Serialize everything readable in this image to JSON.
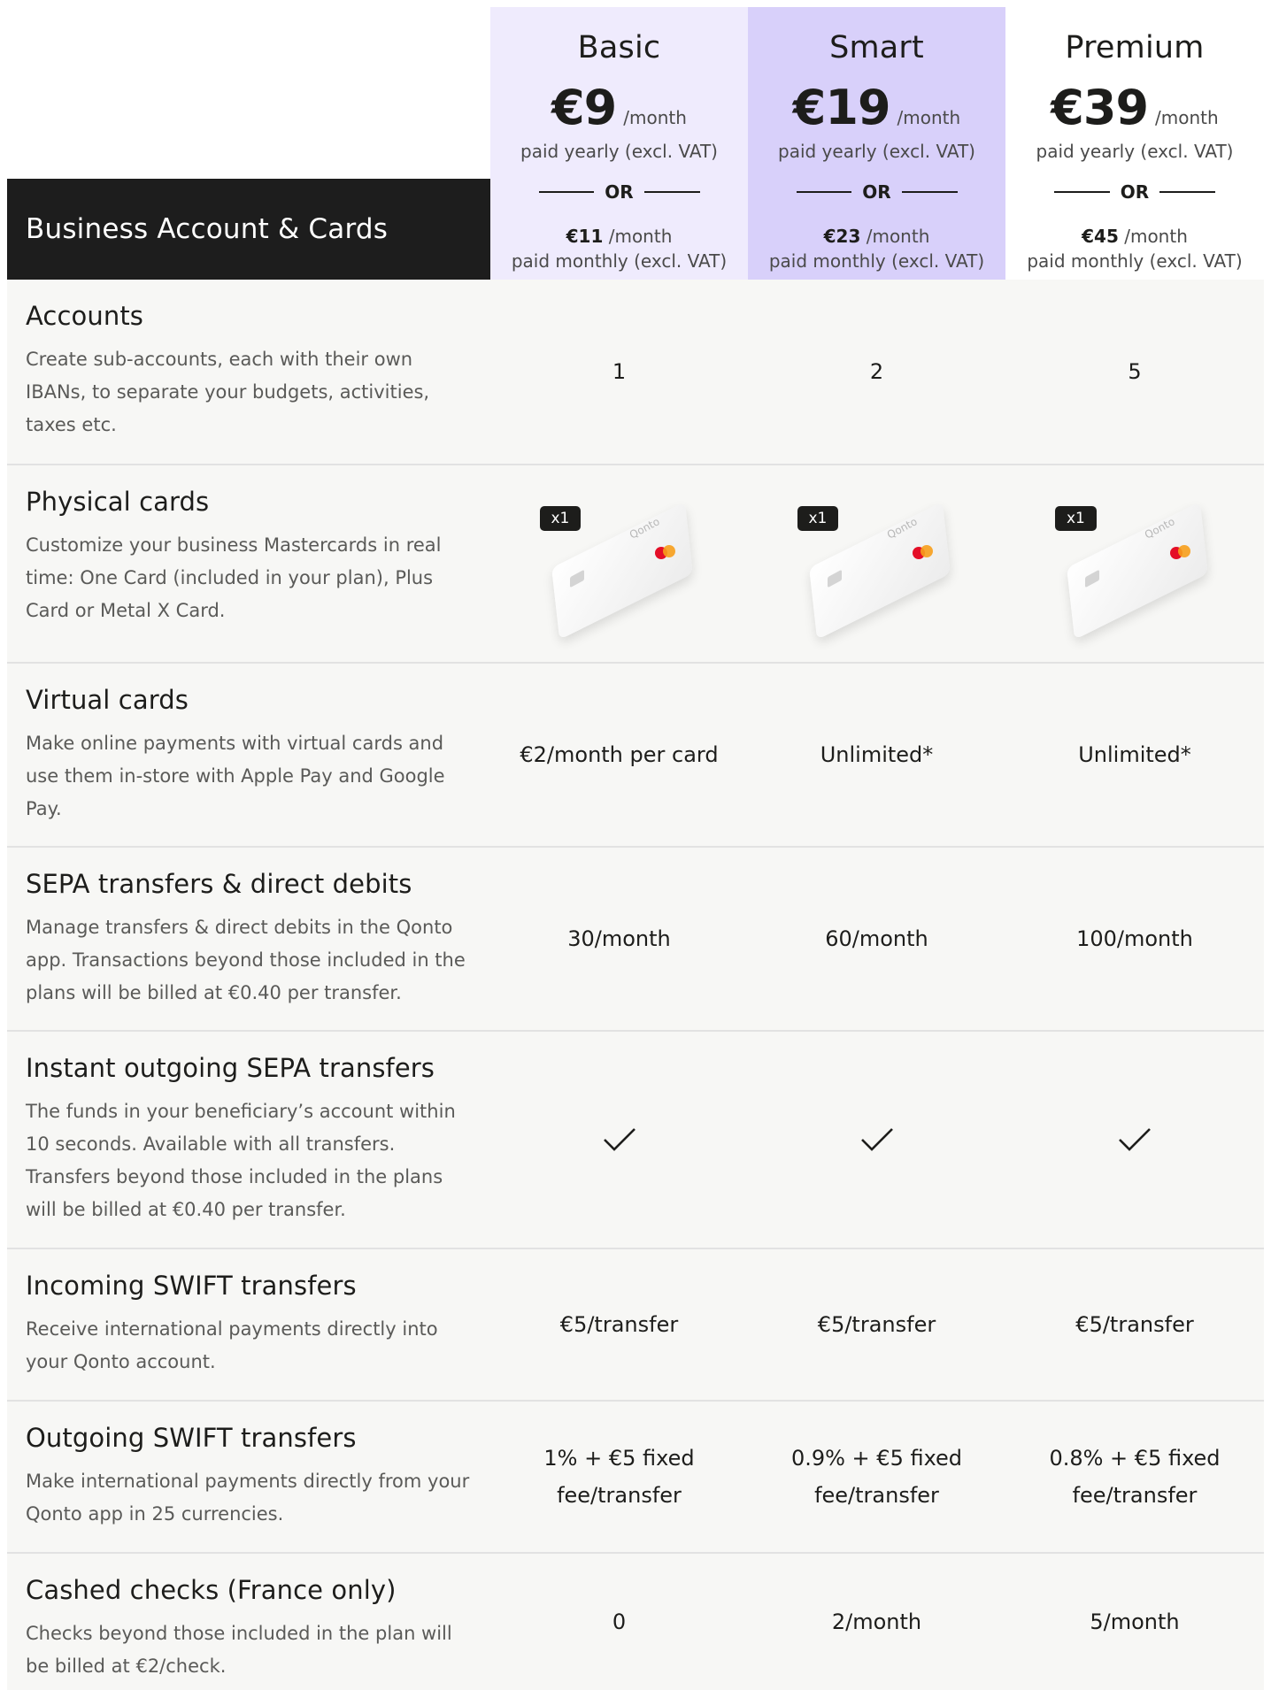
{
  "section_title": "Business Account & Cards",
  "plans": [
    {
      "key": "basic",
      "name": "Basic",
      "price": "€9",
      "unit": "/month",
      "yearly_note": "paid yearly (excl. VAT)",
      "or": "OR",
      "monthly_price": "€11",
      "monthly_unit": "/month",
      "monthly_note": "paid monthly (excl. VAT)"
    },
    {
      "key": "smart",
      "name": "Smart",
      "price": "€19",
      "unit": "/month",
      "yearly_note": "paid yearly (excl. VAT)",
      "or": "OR",
      "monthly_price": "€23",
      "monthly_unit": "/month",
      "monthly_note": "paid monthly (excl. VAT)"
    },
    {
      "key": "premium",
      "name": "Premium",
      "price": "€39",
      "unit": "/month",
      "yearly_note": "paid yearly (excl. VAT)",
      "or": "OR",
      "monthly_price": "€45",
      "monthly_unit": "/month",
      "monthly_note": "paid monthly (excl. VAT)"
    }
  ],
  "colors": {
    "basic_bg": "#efebfd",
    "smart_bg": "#d8d0fa",
    "title_bg": "#1d1d1d",
    "row_bg": "#f7f7f5"
  },
  "rows": [
    {
      "title": "Accounts",
      "desc": "Create sub-accounts, each with their own IBANs, to separate your budgets, activities, taxes etc.",
      "values": [
        "1",
        "2",
        "5"
      ]
    },
    {
      "title": "Physical cards",
      "desc": "Customize your business Mastercards in real time: One Card (included in your plan), Plus Card or Metal X Card.",
      "card_badge": "x1",
      "card_logo": "Qonto",
      "values": [
        "",
        "",
        ""
      ]
    },
    {
      "title": "Virtual cards",
      "desc": "Make online payments with virtual cards and use them in-store with Apple Pay and Google Pay.",
      "values": [
        "€2/month per card",
        "Unlimited*",
        "Unlimited*"
      ]
    },
    {
      "title": "SEPA transfers & direct debits",
      "desc": "Manage transfers & direct debits in the Qonto app. Transactions beyond those included in the plans will be billed at €0.40 per transfer.",
      "values": [
        "30/month",
        "60/month",
        "100/month"
      ]
    },
    {
      "title": "Instant outgoing SEPA transfers",
      "desc": "The funds in your beneficiary’s account within 10 seconds. Available with all transfers. Transfers beyond those included in the plans will be billed at €0.40 per transfer.",
      "icon": "check-icon",
      "values": [
        "",
        "",
        ""
      ]
    },
    {
      "title": "Incoming SWIFT transfers",
      "desc": "Receive international payments directly into your Qonto account.",
      "values": [
        "€5/transfer",
        "€5/transfer",
        "€5/transfer"
      ]
    },
    {
      "title": "Outgoing SWIFT transfers",
      "desc": "Make international payments directly from your Qonto app in 25 currencies.",
      "values": [
        [
          "1% + €5 fixed",
          "fee/transfer"
        ],
        [
          "0.9% + €5 fixed",
          "fee/transfer"
        ],
        [
          "0.8% + €5 fixed",
          "fee/transfer"
        ]
      ]
    },
    {
      "title": "Cashed checks (France only)",
      "desc": "Checks beyond those included in the plan will be billed at €2/check.",
      "values": [
        "0",
        "2/month",
        "5/month"
      ]
    }
  ]
}
